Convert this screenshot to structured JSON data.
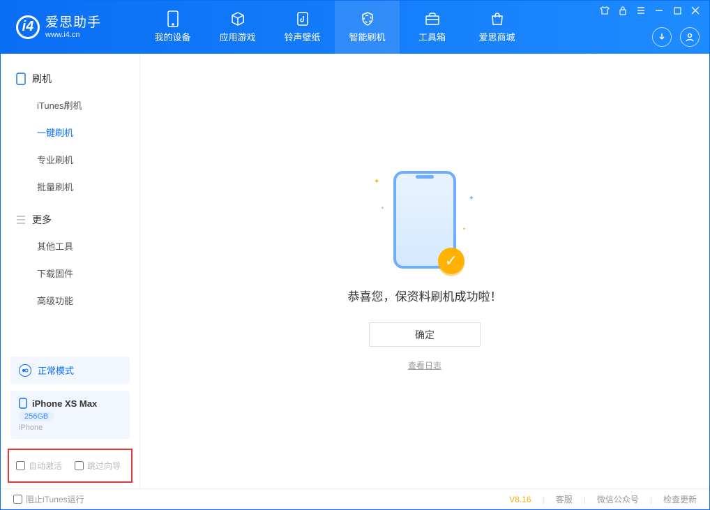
{
  "app": {
    "title": "爱思助手",
    "subtitle": "www.i4.cn"
  },
  "nav": [
    {
      "label": "我的设备",
      "icon": "device"
    },
    {
      "label": "应用游戏",
      "icon": "cube"
    },
    {
      "label": "铃声壁纸",
      "icon": "music"
    },
    {
      "label": "智能刷机",
      "icon": "shield"
    },
    {
      "label": "工具箱",
      "icon": "toolbox"
    },
    {
      "label": "爱思商城",
      "icon": "shop"
    }
  ],
  "nav_active_index": 3,
  "sidebar": {
    "sections": [
      {
        "title": "刷机",
        "items": [
          "iTunes刷机",
          "一键刷机",
          "专业刷机",
          "批量刷机"
        ]
      },
      {
        "title": "更多",
        "items": [
          "其他工具",
          "下载固件",
          "高级功能"
        ]
      }
    ],
    "active": "一键刷机",
    "mode_label": "正常模式",
    "device": {
      "name": "iPhone XS Max",
      "storage": "256GB",
      "type": "iPhone"
    },
    "checkbox1": "自动激活",
    "checkbox2": "跳过向导"
  },
  "main": {
    "message": "恭喜您，保资料刷机成功啦！",
    "confirm_label": "确定",
    "log_link": "查看日志"
  },
  "footer": {
    "stop_itunes": "阻止iTunes运行",
    "version": "V8.16",
    "links": [
      "客服",
      "微信公众号",
      "检查更新"
    ]
  }
}
